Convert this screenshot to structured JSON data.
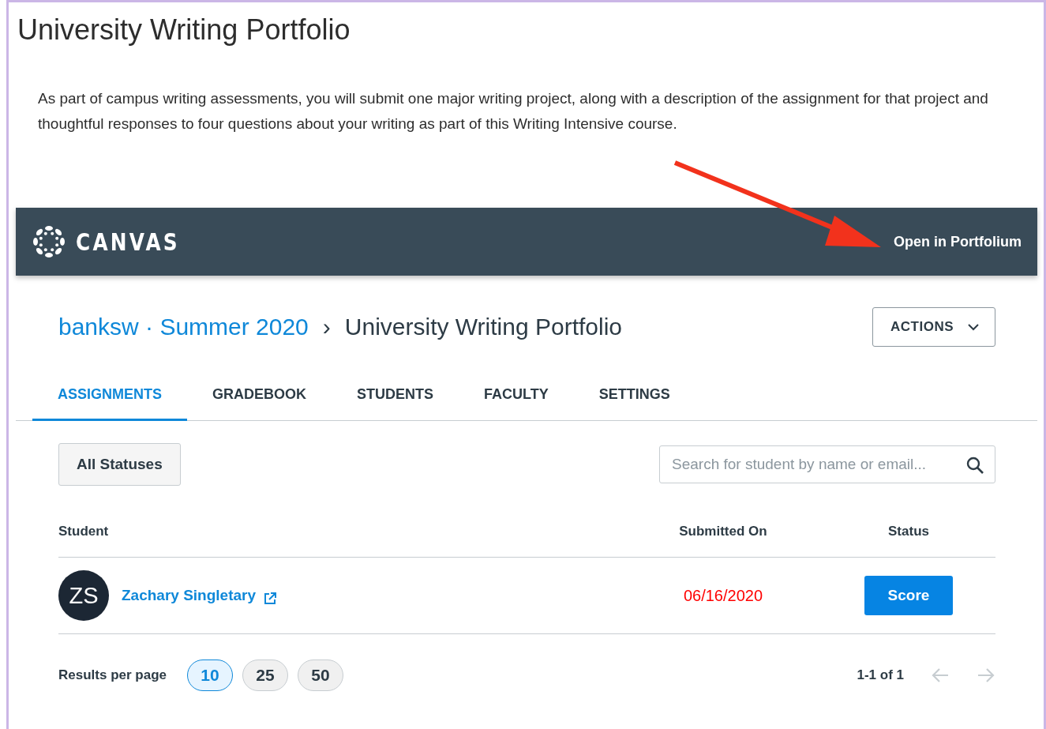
{
  "page": {
    "title": "University Writing Portfolio",
    "description": "As part of campus writing assessments, you will submit one major writing project, along with a description of the assignment for that project and thoughtful responses to four questions about your writing as part of this Writing Intensive course."
  },
  "lti_bar": {
    "brand": "CANVAS",
    "open_link": "Open in Portfolium"
  },
  "breadcrumb": {
    "course": "banksw · Summer 2020",
    "separator": "›",
    "current": "University Writing Portfolio"
  },
  "actions_button": {
    "label": "ACTIONS"
  },
  "tabs": [
    {
      "label": "ASSIGNMENTS",
      "selected": true
    },
    {
      "label": "GRADEBOOK",
      "selected": false
    },
    {
      "label": "STUDENTS",
      "selected": false
    },
    {
      "label": "FACULTY",
      "selected": false
    },
    {
      "label": "SETTINGS",
      "selected": false
    }
  ],
  "status_filter": {
    "label": "All Statuses"
  },
  "search": {
    "placeholder": "Search for student by name or email..."
  },
  "table": {
    "columns": [
      "Student",
      "Submitted On",
      "Status"
    ],
    "rows": [
      {
        "initials": "ZS",
        "student": "Zachary Singletary",
        "submitted_on": "06/16/2020",
        "late": true,
        "action": "Score"
      }
    ]
  },
  "pagination": {
    "label": "Results per page",
    "page_sizes": [
      {
        "label": "10",
        "selected": true
      },
      {
        "label": "25",
        "selected": false
      },
      {
        "label": "50",
        "selected": false
      }
    ],
    "range": "1-1 of 1",
    "prev_disabled": true,
    "next_disabled": true
  }
}
